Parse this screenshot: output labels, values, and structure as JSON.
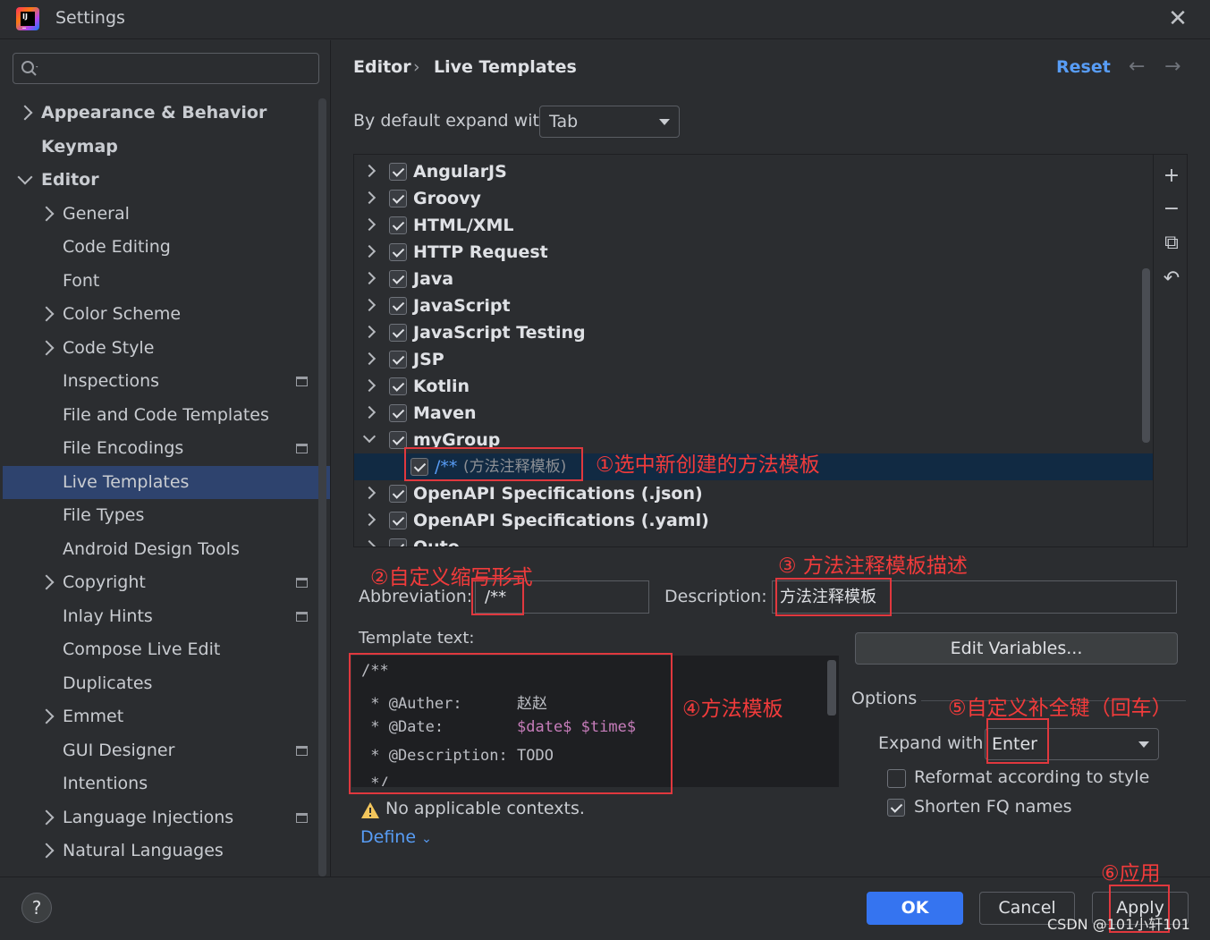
{
  "window": {
    "title": "Settings",
    "close_glyph": "✕"
  },
  "sidebar": {
    "search_placeholder": "",
    "items": [
      {
        "label": "Appearance & Behavior",
        "level": 0,
        "expander": "collapsed",
        "bold": true
      },
      {
        "label": "Keymap",
        "level": 0,
        "expander": "none",
        "bold": true
      },
      {
        "label": "Editor",
        "level": 0,
        "expander": "expanded",
        "bold": true
      },
      {
        "label": "General",
        "level": 1,
        "expander": "collapsed"
      },
      {
        "label": "Code Editing",
        "level": 1,
        "expander": "none"
      },
      {
        "label": "Font",
        "level": 1,
        "expander": "none"
      },
      {
        "label": "Color Scheme",
        "level": 1,
        "expander": "collapsed"
      },
      {
        "label": "Code Style",
        "level": 1,
        "expander": "collapsed"
      },
      {
        "label": "Inspections",
        "level": 1,
        "expander": "none",
        "project_icon": true
      },
      {
        "label": "File and Code Templates",
        "level": 1,
        "expander": "none"
      },
      {
        "label": "File Encodings",
        "level": 1,
        "expander": "none",
        "project_icon": true
      },
      {
        "label": "Live Templates",
        "level": 1,
        "expander": "none",
        "selected": true
      },
      {
        "label": "File Types",
        "level": 1,
        "expander": "none"
      },
      {
        "label": "Android Design Tools",
        "level": 1,
        "expander": "none"
      },
      {
        "label": "Copyright",
        "level": 1,
        "expander": "collapsed",
        "project_icon": true
      },
      {
        "label": "Inlay Hints",
        "level": 1,
        "expander": "none",
        "project_icon": true
      },
      {
        "label": "Compose Live Edit",
        "level": 1,
        "expander": "none"
      },
      {
        "label": "Duplicates",
        "level": 1,
        "expander": "none"
      },
      {
        "label": "Emmet",
        "level": 1,
        "expander": "collapsed"
      },
      {
        "label": "GUI Designer",
        "level": 1,
        "expander": "none",
        "project_icon": true
      },
      {
        "label": "Intentions",
        "level": 1,
        "expander": "none"
      },
      {
        "label": "Language Injections",
        "level": 1,
        "expander": "collapsed",
        "project_icon": true
      },
      {
        "label": "Natural Languages",
        "level": 1,
        "expander": "collapsed"
      }
    ]
  },
  "header": {
    "crumb1": "Editor",
    "sep": "›",
    "crumb2": "Live Templates",
    "reset": "Reset",
    "back": "←",
    "forward": "→"
  },
  "expand_default": {
    "label": "By default expand with",
    "value": "Tab"
  },
  "tree": {
    "rows": [
      {
        "label": "AngularJS",
        "state": "collapsed"
      },
      {
        "label": "Groovy",
        "state": "collapsed"
      },
      {
        "label": "HTML/XML",
        "state": "collapsed"
      },
      {
        "label": "HTTP Request",
        "state": "collapsed"
      },
      {
        "label": "Java",
        "state": "collapsed"
      },
      {
        "label": "JavaScript",
        "state": "collapsed"
      },
      {
        "label": "JavaScript Testing",
        "state": "collapsed"
      },
      {
        "label": "JSP",
        "state": "collapsed"
      },
      {
        "label": "Kotlin",
        "state": "collapsed"
      },
      {
        "label": "Maven",
        "state": "collapsed"
      },
      {
        "label": "myGroup",
        "state": "expanded"
      },
      {
        "label": "/**",
        "desc": "(方法注释模板)",
        "state": "child",
        "selected": true
      },
      {
        "label": "OpenAPI Specifications (.json)",
        "state": "collapsed"
      },
      {
        "label": "OpenAPI Specifications (.yaml)",
        "state": "collapsed"
      },
      {
        "label": "Outo",
        "state": "collapsed"
      }
    ],
    "tools": {
      "add": "+",
      "remove": "−",
      "copy": "⧉",
      "restore": "↶"
    }
  },
  "form": {
    "abbr_label": "Abbreviation:",
    "abbr_value": "/**",
    "desc_label": "Description:",
    "desc_value": "方法注释模板",
    "template_label": "Template text:",
    "template_lines": [
      "/**",
      " * @Auther:      赵赵",
      " * @Date:        $date$ $time$",
      " * @Description: TODO",
      " */"
    ],
    "edit_vars": "Edit Variables...",
    "warning": "No applicable contexts.",
    "define": "Define",
    "options_label": "Options",
    "expand_with_label": "Expand with",
    "expand_with_value": "Enter",
    "reformat_label": "Reformat according to style",
    "reformat_checked": false,
    "shorten_label": "Shorten FQ names",
    "shorten_checked": true
  },
  "footer": {
    "help": "?",
    "ok": "OK",
    "cancel": "Cancel",
    "apply": "Apply"
  },
  "annotations": {
    "n1": "①选中新创建的方法模板",
    "n2": "②自定义缩写形式",
    "n3": "③  方法注释模板描述",
    "n4": "④方法模板",
    "n5": "⑤自定义补全键（回车）",
    "n6": "⑥应用"
  },
  "watermark": "CSDN @101小轩101",
  "colors": {
    "accent": "#3574f0",
    "link": "#589df6",
    "selection": "#2e436e",
    "annotation": "#e0383e"
  }
}
